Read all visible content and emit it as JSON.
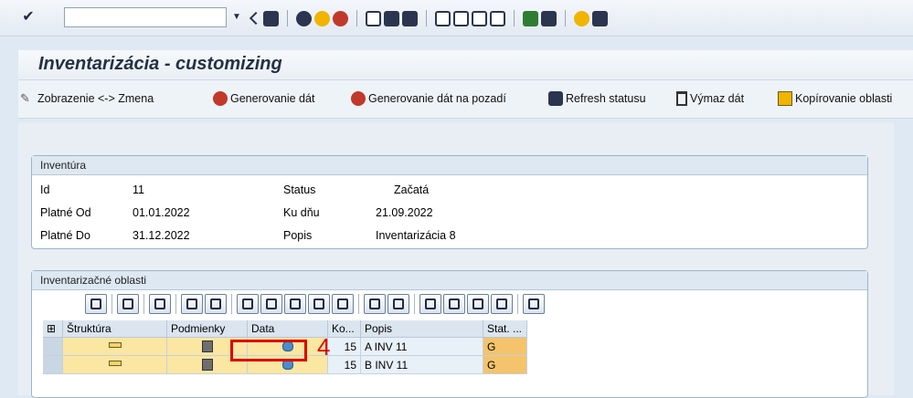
{
  "systoolbar": {
    "check_icon": "check-icon",
    "command_value": "",
    "icons": [
      "dropdown-icon",
      "back-arrow-icon",
      "save-icon",
      "back-icon",
      "exit-icon",
      "cancel-icon",
      "print-icon",
      "find-icon",
      "find-next-icon",
      "first-page-icon",
      "previous-page-icon",
      "next-page-icon",
      "last-page-icon",
      "new-session-icon",
      "shortcut-icon",
      "help-icon",
      "layout-icon"
    ]
  },
  "title": "Inventarizácia - customizing",
  "app_toolbar": {
    "btn1": "Zobrazenie <-> Zmena",
    "btn2": "Generovanie dát",
    "btn3": "Generovanie dát na pozadí",
    "btn4": "Refresh statusu",
    "btn5": "Výmaz dát",
    "btn6": "Kopírovanie oblasti"
  },
  "inventura": {
    "header": "Inventúra",
    "id_label": "Id",
    "id_value": "11",
    "status_label": "Status",
    "status_value": "Začatá",
    "from_label": "Platné Od",
    "from_value": "01.01.2022",
    "day_label": "Ku dňu",
    "day_value": "21.09.2022",
    "to_label": "Platné Do",
    "to_value": "31.12.2022",
    "desc_label": "Popis",
    "desc_value": "Inventarizácia 8"
  },
  "oblasti": {
    "header": "Inventarizačné oblasti",
    "columns": [
      "Štruktúra",
      "Podmienky",
      "Data",
      "Ko...",
      "Popis",
      "Stat. ..."
    ],
    "rows": [
      {
        "ko": "15",
        "popis": "A INV 11",
        "stat": "G"
      },
      {
        "ko": "15",
        "popis": "B INV 11",
        "stat": "G"
      }
    ]
  },
  "annotation": {
    "number": "4",
    "color": "#e00000"
  },
  "colors": {
    "accent": "#e00000",
    "title": "#253144",
    "status_cell": "#f4c36b",
    "icon_cell": "#fbe6a2"
  }
}
